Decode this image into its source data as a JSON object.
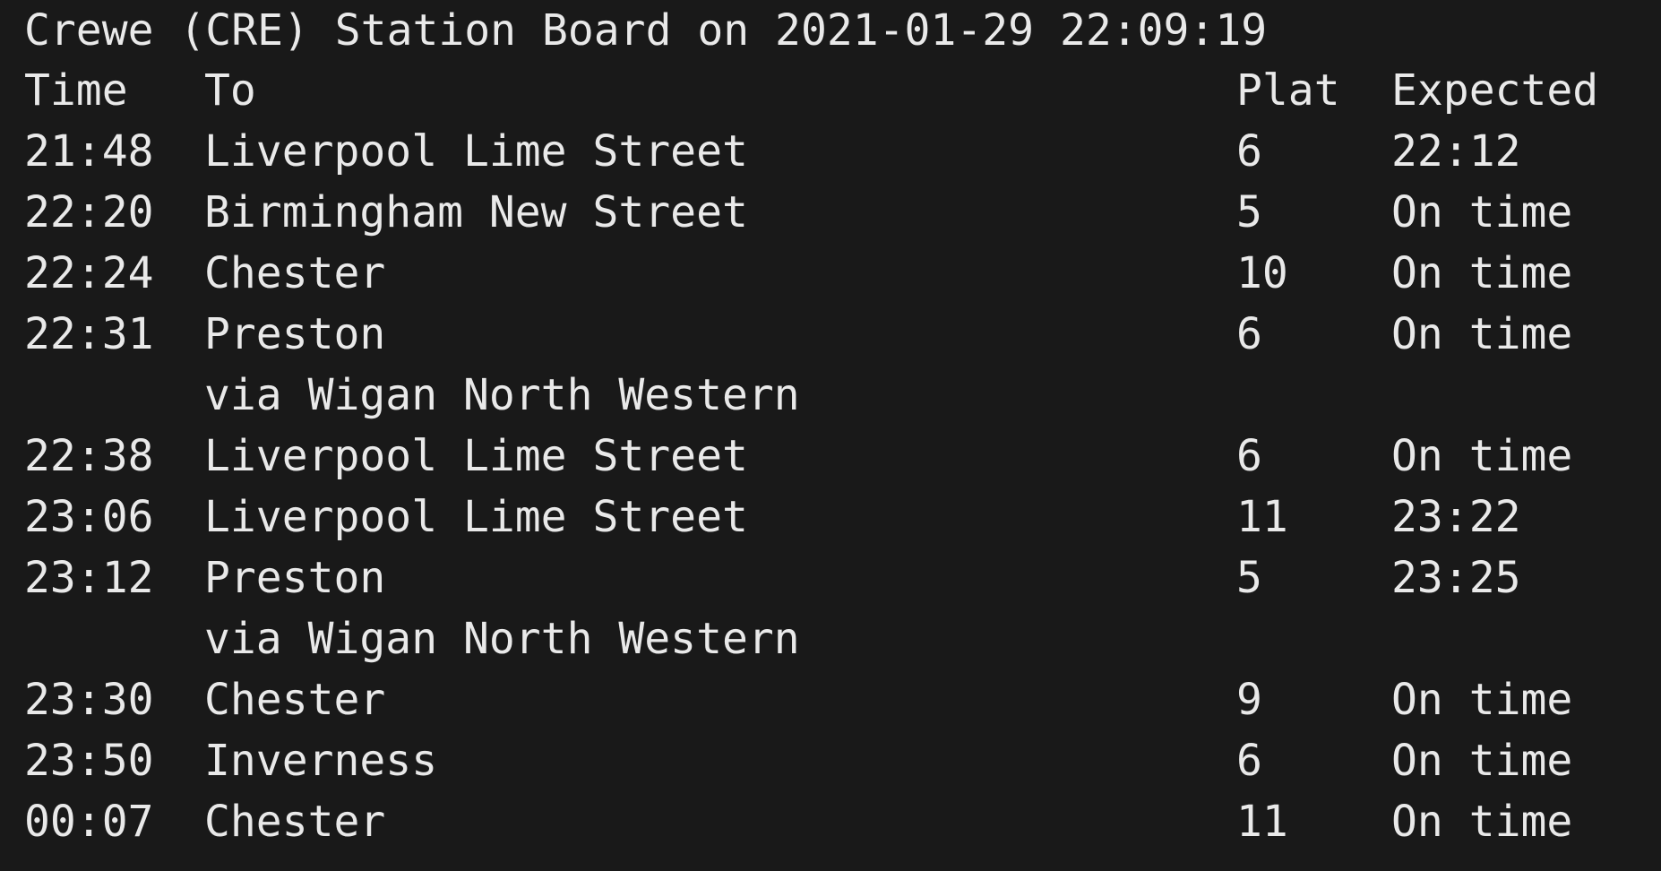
{
  "board": {
    "title": "Crewe (CRE) Station Board on 2021-01-29 22:09:19",
    "headers": {
      "time": "Time",
      "to": "To",
      "plat": "Plat",
      "expected": "Expected"
    },
    "rows": [
      {
        "time": "21:48",
        "to": "Liverpool Lime Street",
        "plat": "6",
        "expected": "22:12"
      },
      {
        "time": "22:20",
        "to": "Birmingham New Street",
        "plat": "5",
        "expected": "On time"
      },
      {
        "time": "22:24",
        "to": "Chester",
        "plat": "10",
        "expected": "On time"
      },
      {
        "time": "22:31",
        "to": "Preston",
        "plat": "6",
        "expected": "On time"
      },
      {
        "time": "",
        "to": "via Wigan North Western",
        "plat": "",
        "expected": ""
      },
      {
        "time": "22:38",
        "to": "Liverpool Lime Street",
        "plat": "6",
        "expected": "On time"
      },
      {
        "time": "23:06",
        "to": "Liverpool Lime Street",
        "plat": "11",
        "expected": "23:22"
      },
      {
        "time": "23:12",
        "to": "Preston",
        "plat": "5",
        "expected": "23:25"
      },
      {
        "time": "",
        "to": "via Wigan North Western",
        "plat": "",
        "expected": ""
      },
      {
        "time": "23:30",
        "to": "Chester",
        "plat": "9",
        "expected": "On time"
      },
      {
        "time": "23:50",
        "to": "Inverness",
        "plat": "6",
        "expected": "On time"
      },
      {
        "time": "00:07",
        "to": "Chester",
        "plat": "11",
        "expected": "On time"
      }
    ]
  },
  "colors": {
    "background": "#191919",
    "text": "#e9e9e9"
  }
}
